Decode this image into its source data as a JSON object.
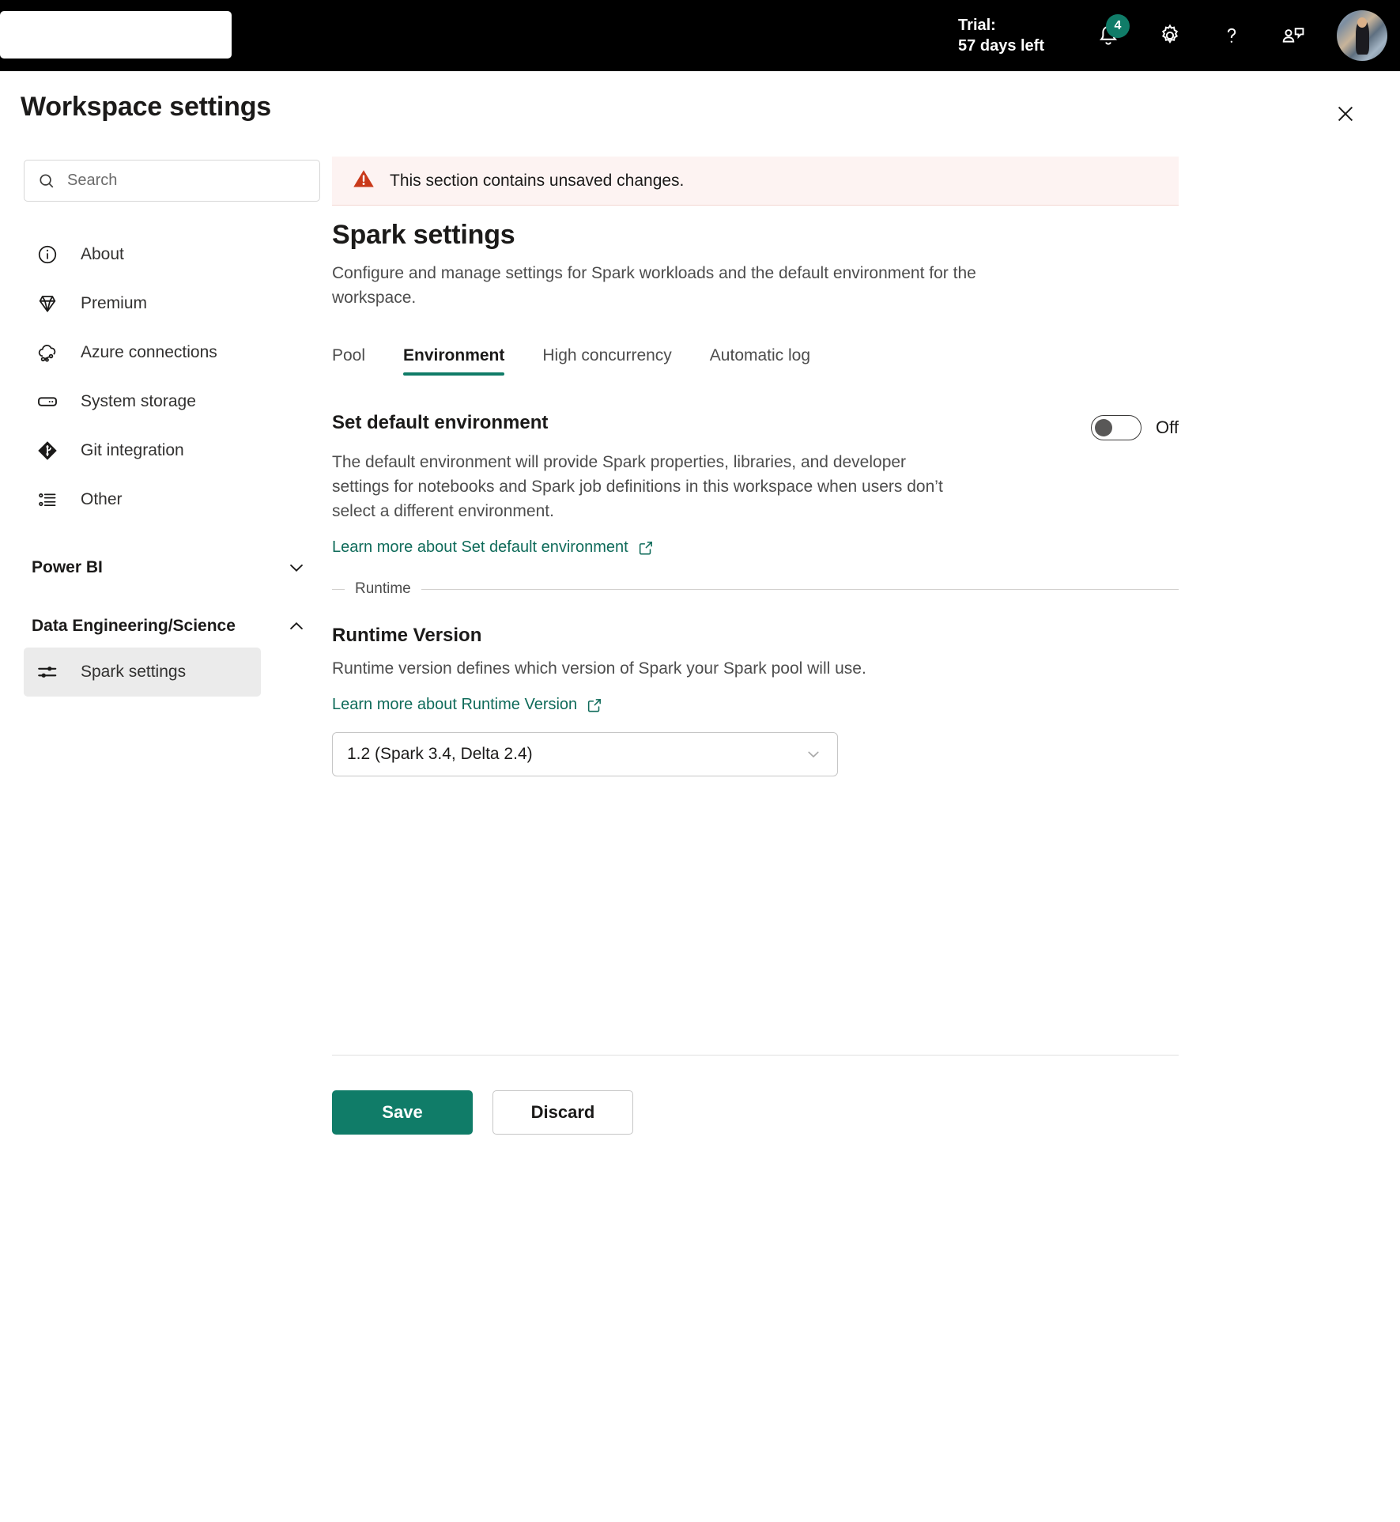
{
  "topbar": {
    "trial_label": "Trial:",
    "trial_days": "57 days left",
    "notification_count": "4",
    "icons": {
      "bell": "bell-icon",
      "settings": "gear-icon",
      "help": "question-mark-icon",
      "feedback": "feedback-icon",
      "avatar": "user-avatar"
    }
  },
  "panel": {
    "title": "Workspace settings",
    "close_label": "Close"
  },
  "sidebar": {
    "search": {
      "placeholder": "Search",
      "value": ""
    },
    "items": [
      {
        "label": "About",
        "icon": "info-circle-icon"
      },
      {
        "label": "Premium",
        "icon": "diamond-icon"
      },
      {
        "label": "Azure connections",
        "icon": "cloud-link-icon"
      },
      {
        "label": "System storage",
        "icon": "storage-icon"
      },
      {
        "label": "Git integration",
        "icon": "git-icon"
      },
      {
        "label": "Other",
        "icon": "list-icon"
      }
    ],
    "groups": [
      {
        "title": "Power BI",
        "expanded": false,
        "chevron": "chevron-down-icon",
        "children": []
      },
      {
        "title": "Data Engineering/Science",
        "expanded": true,
        "chevron": "chevron-up-icon",
        "children": [
          {
            "label": "Spark settings",
            "icon": "sliders-icon",
            "active": true
          }
        ]
      }
    ]
  },
  "main": {
    "banner": {
      "icon": "warning-triangle-icon",
      "text": "This section contains unsaved changes.",
      "background": "#fdf3f2",
      "icon_color": "#c9391a"
    },
    "title": "Spark settings",
    "description": "Configure and manage settings for Spark workloads and the default environment for the workspace.",
    "tabs": [
      {
        "label": "Pool",
        "active": false
      },
      {
        "label": "Environment",
        "active": true
      },
      {
        "label": "High concurrency",
        "active": false
      },
      {
        "label": "Automatic log",
        "active": false
      }
    ],
    "default_environment": {
      "heading": "Set default environment",
      "toggle_state": "Off",
      "toggle_on": false,
      "description": "The default environment will provide Spark properties, libraries, and developer settings for notebooks and Spark job definitions in this workspace when users don’t select a different environment.",
      "learn_more": "Learn more about Set default environment",
      "learn_more_icon": "external-link-icon"
    },
    "runtime_fieldset_legend": "Runtime",
    "runtime_version": {
      "heading": "Runtime Version",
      "description": "Runtime version defines which version of Spark your Spark pool will use.",
      "learn_more": "Learn more about Runtime Version",
      "learn_more_icon": "external-link-icon",
      "selected": "1.2 (Spark 3.4, Delta 2.4)",
      "chevron": "chevron-down-icon"
    },
    "footer": {
      "save_label": "Save",
      "discard_label": "Discard"
    }
  },
  "colors": {
    "accent": "#107c68",
    "link": "#0f6b5a",
    "warning": "#c9391a",
    "topbar_bg": "#000000"
  }
}
